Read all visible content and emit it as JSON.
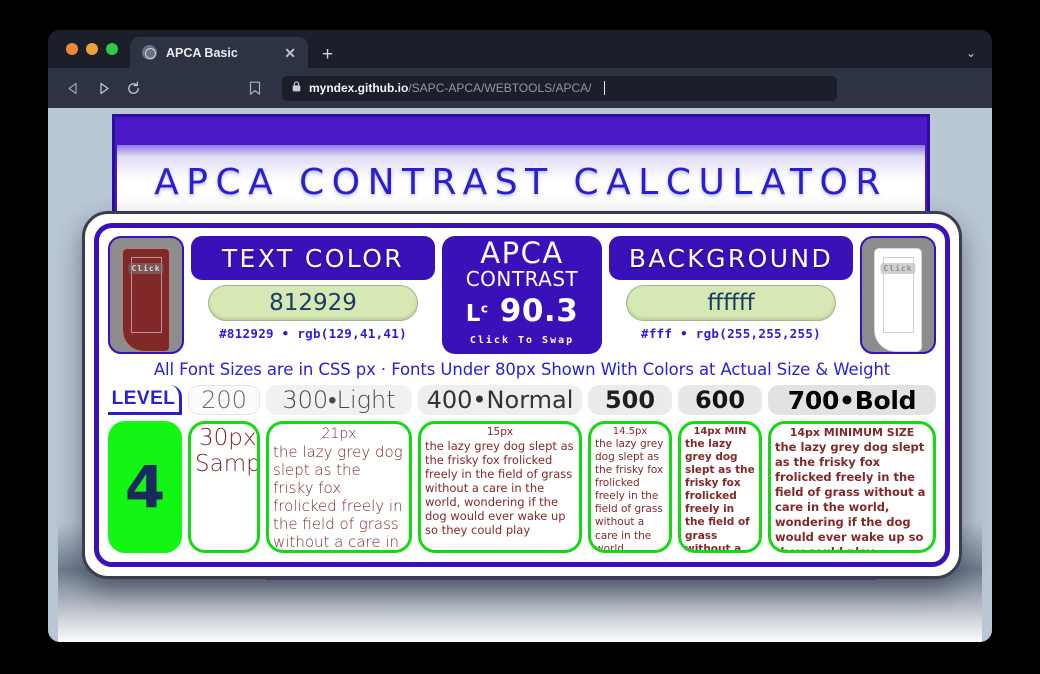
{
  "browser": {
    "tab": {
      "title": "APCA Basic",
      "close_label": "✕",
      "favicon": "globe-icon"
    },
    "new_tab_label": "+",
    "tabstrip_chevron": "⌄",
    "omnibox": {
      "lock": "🔒",
      "host": "myndex.github.io",
      "path": "/SAPC-APCA/WEBTOOLS/APCA/"
    }
  },
  "page": {
    "app_title": "APCA CONTRAST CALCULATOR",
    "text_color": {
      "heading": "TEXT COLOR",
      "value": "812929",
      "meta": "#812929 • rgb(129,41,41)",
      "hex": "#812929",
      "swatch_click_label": "Click"
    },
    "background_color": {
      "heading": "BACKGROUND",
      "value": "ffffff",
      "meta": "#fff • rgb(255,255,255)",
      "hex": "#ffffff",
      "swatch_click_label": "Click"
    },
    "apca": {
      "word": "APCA",
      "sub": "CONTRAST",
      "lc_prefix": "L",
      "lc_sup": "c",
      "value": "90.3",
      "swap_label": "Click To Swap"
    },
    "notice": "All Font Sizes are in CSS px · Fonts Under 80px Shown With Colors at Actual Size & Weight",
    "level_label": "LEVEL",
    "level_value": "4",
    "weights": [
      {
        "label": "200"
      },
      {
        "label": "300•Light"
      },
      {
        "label": "400•Normal"
      },
      {
        "label": "500"
      },
      {
        "label": "600"
      },
      {
        "label": "700•Bold"
      }
    ],
    "samples": [
      {
        "size_label": "30px",
        "body": "Sample"
      },
      {
        "size_label": "21px",
        "body": "the lazy grey dog slept as the frisky fox frolicked freely in the field of grass without a care in the world, wondering if the dog would ever wake up so they could play"
      },
      {
        "size_label": "15px",
        "body": "the lazy grey dog slept as the frisky fox frolicked freely in the field of grass without a care in the world, wondering if the dog would ever wake up so they could play"
      },
      {
        "size_label": "14.5px",
        "body": "the lazy grey dog slept as the frisky fox frolicked freely in the field of grass without a care in the world, wondering if the dog would ever wake up so they could play"
      },
      {
        "size_label": "14px MIN",
        "body": "the lazy grey dog slept as the frisky fox frolicked freely in the field of grass without a care in the world, wondering if the dog would ever wake up so they could play"
      },
      {
        "size_label": "14px MINIMUM SIZE",
        "body": "the lazy grey dog slept as the frisky fox frolicked freely in the field of grass without a care in the world, wondering if the dog would ever wake up so they could play"
      }
    ],
    "colors": {
      "brand_purple": "#3a10b8",
      "title_blue": "#2a1fd0",
      "input_green": "#d6e9b4",
      "level_green": "#13f513",
      "sample_text": "#812929",
      "page_bg": "#b9c6d4"
    }
  }
}
